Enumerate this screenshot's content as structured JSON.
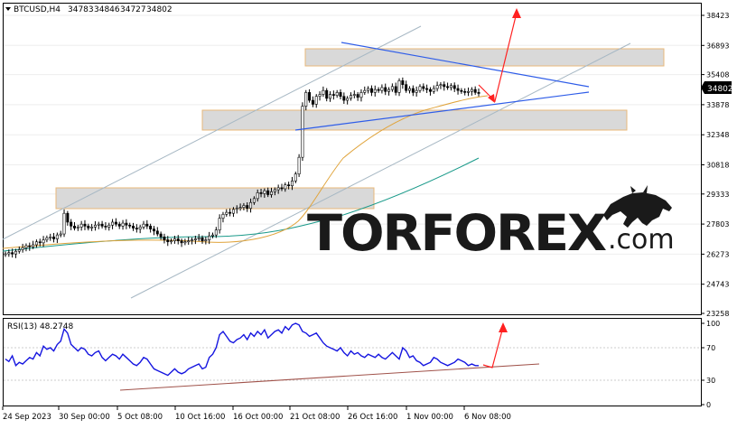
{
  "chart_data": [
    {
      "type": "candlestick",
      "title": "BTCUSD,H4",
      "ohlc": {
        "open": "34783",
        "high": "34846",
        "low": "34727",
        "close": "34802"
      },
      "current_price": "34802",
      "y_ticks": [
        "38423",
        "36893",
        "35408",
        "33878",
        "32348",
        "30818",
        "29333",
        "27803",
        "26273",
        "24743",
        "23258"
      ],
      "ylim": [
        23258,
        38423
      ],
      "x_ticks": [
        "24 Sep 2023",
        "30 Sep 00:00",
        "5 Oct 08:00",
        "10 Oct 16:00",
        "16 Oct 00:00",
        "21 Oct 08:00",
        "26 Oct 16:00",
        "1 Nov 00:00",
        "6 Nov 08:00"
      ],
      "close_series": [
        26290,
        26350,
        26280,
        26420,
        26500,
        26600,
        26700,
        26650,
        26750,
        26900,
        26850,
        27000,
        27100,
        27150,
        27050,
        27250,
        27300,
        28350,
        27900,
        27700,
        27600,
        27650,
        27800,
        27700,
        27600,
        27650,
        27750,
        27800,
        27700,
        27650,
        27750,
        27900,
        27800,
        27700,
        27850,
        27750,
        27700,
        27600,
        27550,
        27650,
        27800,
        27700,
        27550,
        27450,
        27300,
        27150,
        27000,
        26900,
        26950,
        27050,
        26950,
        26850,
        26900,
        26950,
        27000,
        27050,
        27100,
        26950,
        27000,
        27200,
        27250,
        27500,
        28100,
        28300,
        28400,
        28350,
        28550,
        28600,
        28650,
        28750,
        28600,
        28900,
        29100,
        29400,
        29350,
        29500,
        29300,
        29450,
        29550,
        29650,
        29600,
        29800,
        29750,
        30000,
        30350,
        31200,
        33800,
        34500,
        34100,
        33900,
        34300,
        34400,
        34600,
        34200,
        34400,
        34350,
        34500,
        34300,
        34100,
        34200,
        34350,
        34400,
        34250,
        34500,
        34600,
        34700,
        34500,
        34650,
        34600,
        34750,
        34550,
        34650,
        34800,
        34500,
        35100,
        34900,
        34600,
        34700,
        34500,
        34600,
        34800,
        34700,
        34650,
        34550,
        34700,
        34850,
        34900,
        34800,
        34750,
        34850,
        34700,
        34600,
        34550,
        34500,
        34550,
        34650,
        34500,
        34450
      ]
    },
    {
      "type": "line",
      "title": "RSI(13) 48.2748",
      "y_ticks": [
        "100",
        "70",
        "30",
        "0"
      ],
      "ylim": [
        0,
        100
      ],
      "series": [
        {
          "values": [
            56,
            53,
            60,
            48,
            52,
            50,
            54,
            58,
            56,
            64,
            60,
            72,
            68,
            70,
            66,
            74,
            78,
            93,
            88,
            74,
            70,
            66,
            70,
            68,
            62,
            60,
            64,
            66,
            58,
            54,
            58,
            62,
            60,
            56,
            62,
            58,
            54,
            50,
            48,
            52,
            58,
            56,
            50,
            44,
            42,
            40,
            38,
            36,
            40,
            44,
            40,
            38,
            40,
            44,
            46,
            48,
            50,
            44,
            46,
            58,
            62,
            70,
            86,
            90,
            84,
            78,
            76,
            80,
            82,
            86,
            80,
            88,
            84,
            90,
            86,
            92,
            82,
            86,
            90,
            92,
            88,
            96,
            92,
            98,
            100,
            98,
            90,
            88,
            84,
            86,
            88,
            82,
            76,
            72,
            70,
            68,
            66,
            70,
            64,
            60,
            66,
            62,
            64,
            60,
            58,
            62,
            60,
            58,
            62,
            58,
            56,
            60,
            64,
            60,
            56,
            70,
            66,
            58,
            60,
            54,
            52,
            48,
            50,
            52,
            58,
            56,
            52,
            50,
            48,
            50,
            52,
            56,
            54,
            52,
            48,
            50,
            48,
            48
          ]
        }
      ]
    }
  ],
  "watermark": {
    "brand": "TORFOREX",
    "suffix": ".com"
  }
}
